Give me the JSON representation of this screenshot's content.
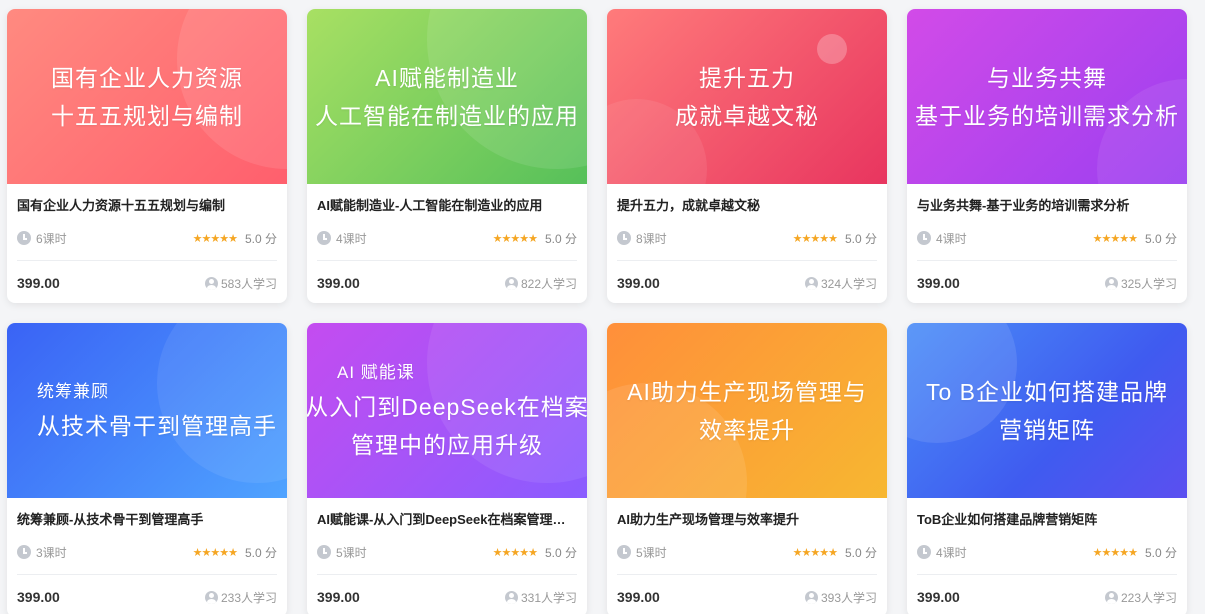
{
  "courses": [
    {
      "cover_lines": [
        "国有企业人力资源",
        "十五五规划与编制"
      ],
      "cover_bg": "linear-gradient(135deg, #ff8a80 0%, #ff5f6d 100%)",
      "title": "国有企业人力资源十五五规划与编制",
      "hours": "6课时",
      "stars": "★★★★★",
      "score": "5.0 分",
      "price": "399.00",
      "learners": "583人学习"
    },
    {
      "cover_lines": [
        "AI赋能制造业",
        "人工智能在制造业的应用"
      ],
      "cover_bg": "linear-gradient(135deg, #a8e063 0%, #56c05a 100%)",
      "title": "AI赋能制造业-人工智能在制造业的应用",
      "hours": "4课时",
      "stars": "★★★★★",
      "score": "5.0 分",
      "price": "399.00",
      "learners": "822人学习"
    },
    {
      "cover_lines": [
        "提升五力",
        "成就卓越文秘"
      ],
      "cover_bg": "linear-gradient(135deg, #ff7b7b 0%, #e8355f 100%)",
      "title": "提升五力，成就卓越文秘",
      "hours": "8课时",
      "stars": "★★★★★",
      "score": "5.0 分",
      "price": "399.00",
      "learners": "324人学习"
    },
    {
      "cover_lines": [
        "与业务共舞",
        "基于业务的培训需求分析"
      ],
      "cover_bg": "linear-gradient(135deg, #d24be8 0%, #9b3ff0 100%)",
      "title": "与业务共舞-基于业务的培训需求分析",
      "hours": "4课时",
      "stars": "★★★★★",
      "score": "5.0 分",
      "price": "399.00",
      "learners": "325人学习"
    },
    {
      "cover_lines": [
        "统筹兼顾",
        "从技术骨干到管理高手"
      ],
      "cover_bg": "linear-gradient(135deg, #3a63f5 0%, #4fa3ff 100%)",
      "title": "统筹兼顾-从技术骨干到管理高手",
      "hours": "3课时",
      "stars": "★★★★★",
      "score": "5.0 分",
      "price": "399.00",
      "learners": "233人学习"
    },
    {
      "cover_lines": [
        "AI 赋能课",
        "从入门到DeepSeek在档案",
        "管理中的应用升级"
      ],
      "cover_bg": "linear-gradient(135deg, #c44cf0 0%, #8a5cff 100%)",
      "title": "AI赋能课-从入门到DeepSeek在档案管理中的应用升级",
      "hours": "5课时",
      "stars": "★★★★★",
      "score": "5.0 分",
      "price": "399.00",
      "learners": "331人学习"
    },
    {
      "cover_lines": [
        "AI助力生产现场管理与",
        "效率提升"
      ],
      "cover_bg": "linear-gradient(135deg, #ff8f3a 0%, #f7b731 100%)",
      "title": "AI助力生产现场管理与效率提升",
      "hours": "5课时",
      "stars": "★★★★★",
      "score": "5.0 分",
      "price": "399.00",
      "learners": "393人学习"
    },
    {
      "cover_lines": [
        "To B企业如何搭建品牌",
        "营销矩阵"
      ],
      "cover_bg": "linear-gradient(135deg, #4a8df7 0%, #3f5bf0 60%, #5b4ff0 100%)",
      "title": "ToB企业如何搭建品牌营销矩阵",
      "hours": "4课时",
      "stars": "★★★★★",
      "score": "5.0 分",
      "price": "399.00",
      "learners": "223人学习"
    }
  ]
}
